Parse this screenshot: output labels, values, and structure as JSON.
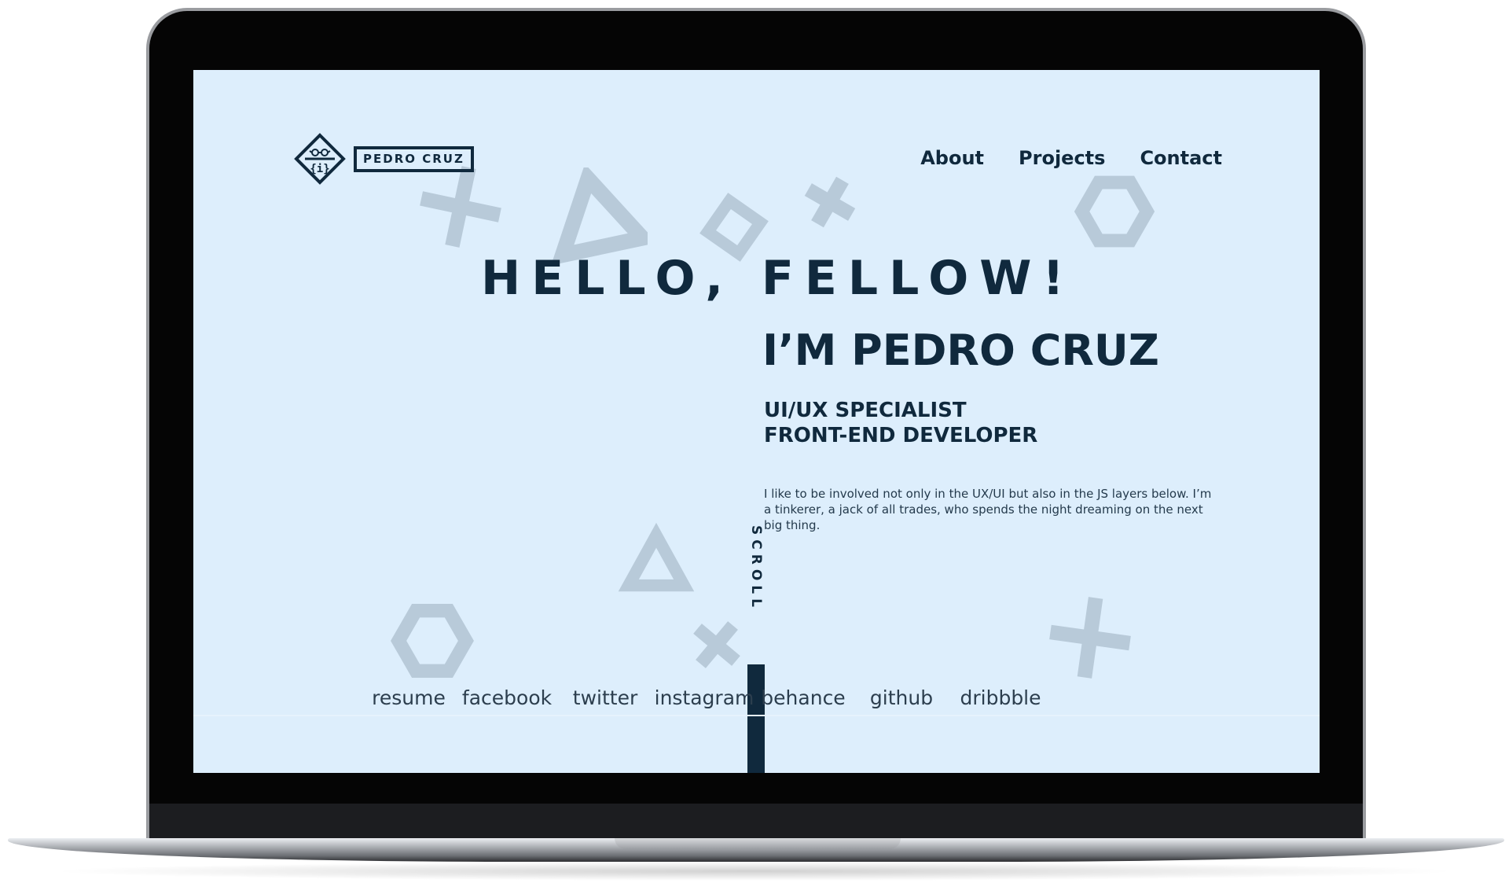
{
  "logo": {
    "text": "PEDRO CRUZ"
  },
  "nav": [
    {
      "label": "About"
    },
    {
      "label": "Projects"
    },
    {
      "label": "Contact"
    }
  ],
  "hero": {
    "greeting": "HELLO, FELLOW!",
    "name": "I’M PEDRO CRUZ",
    "role_line1": "UI/UX SPECIALIST",
    "role_line2": "FRONT-END DEVELOPER",
    "bio": "I like to be involved not only in the UX/UI but also in the JS layers below. I’m a tinkerer, a jack of all trades, who spends the night dreaming on the next big thing."
  },
  "scroll": {
    "label": "SCROLL"
  },
  "social": [
    {
      "label": "resume"
    },
    {
      "label": "facebook"
    },
    {
      "label": "twitter"
    },
    {
      "label": "instagram"
    },
    {
      "label": "behance"
    },
    {
      "label": "github"
    },
    {
      "label": "dribbble"
    }
  ],
  "colors": {
    "background": "#ddeefc",
    "primary": "#10293d",
    "shape": "#b8cad9",
    "frame": "#050505"
  }
}
